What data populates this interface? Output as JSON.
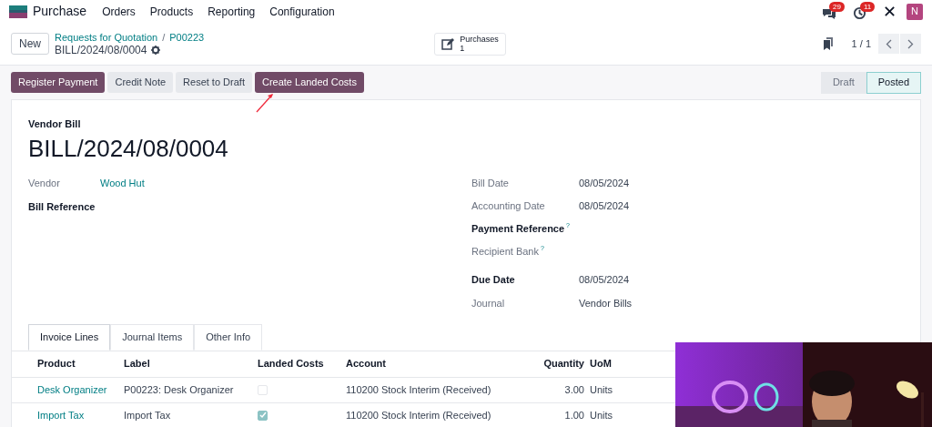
{
  "app": {
    "name": "Purchase"
  },
  "menu": [
    "Orders",
    "Products",
    "Reporting",
    "Configuration"
  ],
  "notifications": [
    {
      "kind": "messages",
      "count": "29"
    },
    {
      "kind": "activities",
      "count": "11"
    }
  ],
  "user": {
    "initial": "N"
  },
  "breadcrumb": {
    "items": [
      "Requests for Quotation",
      "P00223"
    ],
    "separator": "/",
    "current": "BILL/2024/08/0004"
  },
  "new_button": "New",
  "smart_button": {
    "label": "Purchases",
    "count": "1"
  },
  "pager": "1 / 1",
  "actions": [
    {
      "label": "Register Payment",
      "primary": true
    },
    {
      "label": "Credit Note",
      "primary": false
    },
    {
      "label": "Reset to Draft",
      "primary": false
    },
    {
      "label": "Create Landed Costs",
      "primary": true
    }
  ],
  "statuses": [
    {
      "label": "Draft",
      "selected": false
    },
    {
      "label": "Posted",
      "selected": true
    }
  ],
  "form": {
    "type_label": "Vendor Bill",
    "title": "BILL/2024/08/0004",
    "left_fields": [
      {
        "label": "Vendor",
        "value": "Wood Hut",
        "link": true,
        "emphasized": false
      },
      {
        "label": "Bill Reference",
        "emphasized": true
      }
    ],
    "right_fields": [
      {
        "label": "Bill Date",
        "value": "08/05/2024",
        "emphasized": false
      },
      {
        "label": "Accounting Date",
        "value": "08/05/2024",
        "emphasized": false
      },
      {
        "label": "Payment Reference",
        "help": "?",
        "emphasized": true
      },
      {
        "label": "Recipient Bank",
        "help": "?",
        "emphasized": false
      },
      {
        "label": "Due Date",
        "value": "08/05/2024",
        "emphasized": true
      },
      {
        "label": "Journal",
        "value": "Vendor Bills",
        "emphasized": false
      }
    ]
  },
  "tabs": [
    {
      "label": "Invoice Lines",
      "selected": true
    },
    {
      "label": "Journal Items",
      "selected": false
    },
    {
      "label": "Other Info",
      "selected": false
    }
  ],
  "table": {
    "columns": [
      "Product",
      "Label",
      "Landed Costs",
      "Account",
      "Quantity",
      "UoM"
    ],
    "rows": [
      {
        "product": "Desk Organizer",
        "label": "P00223: Desk Organizer",
        "landed_costs": false,
        "account": "110200 Stock Interim (Received)",
        "quantity": "3.00",
        "uom": "Units"
      },
      {
        "product": "Import Tax",
        "label": "Import Tax",
        "landed_costs": true,
        "account": "110200 Stock Interim (Received)",
        "quantity": "1.00",
        "uom": "Units"
      }
    ]
  }
}
